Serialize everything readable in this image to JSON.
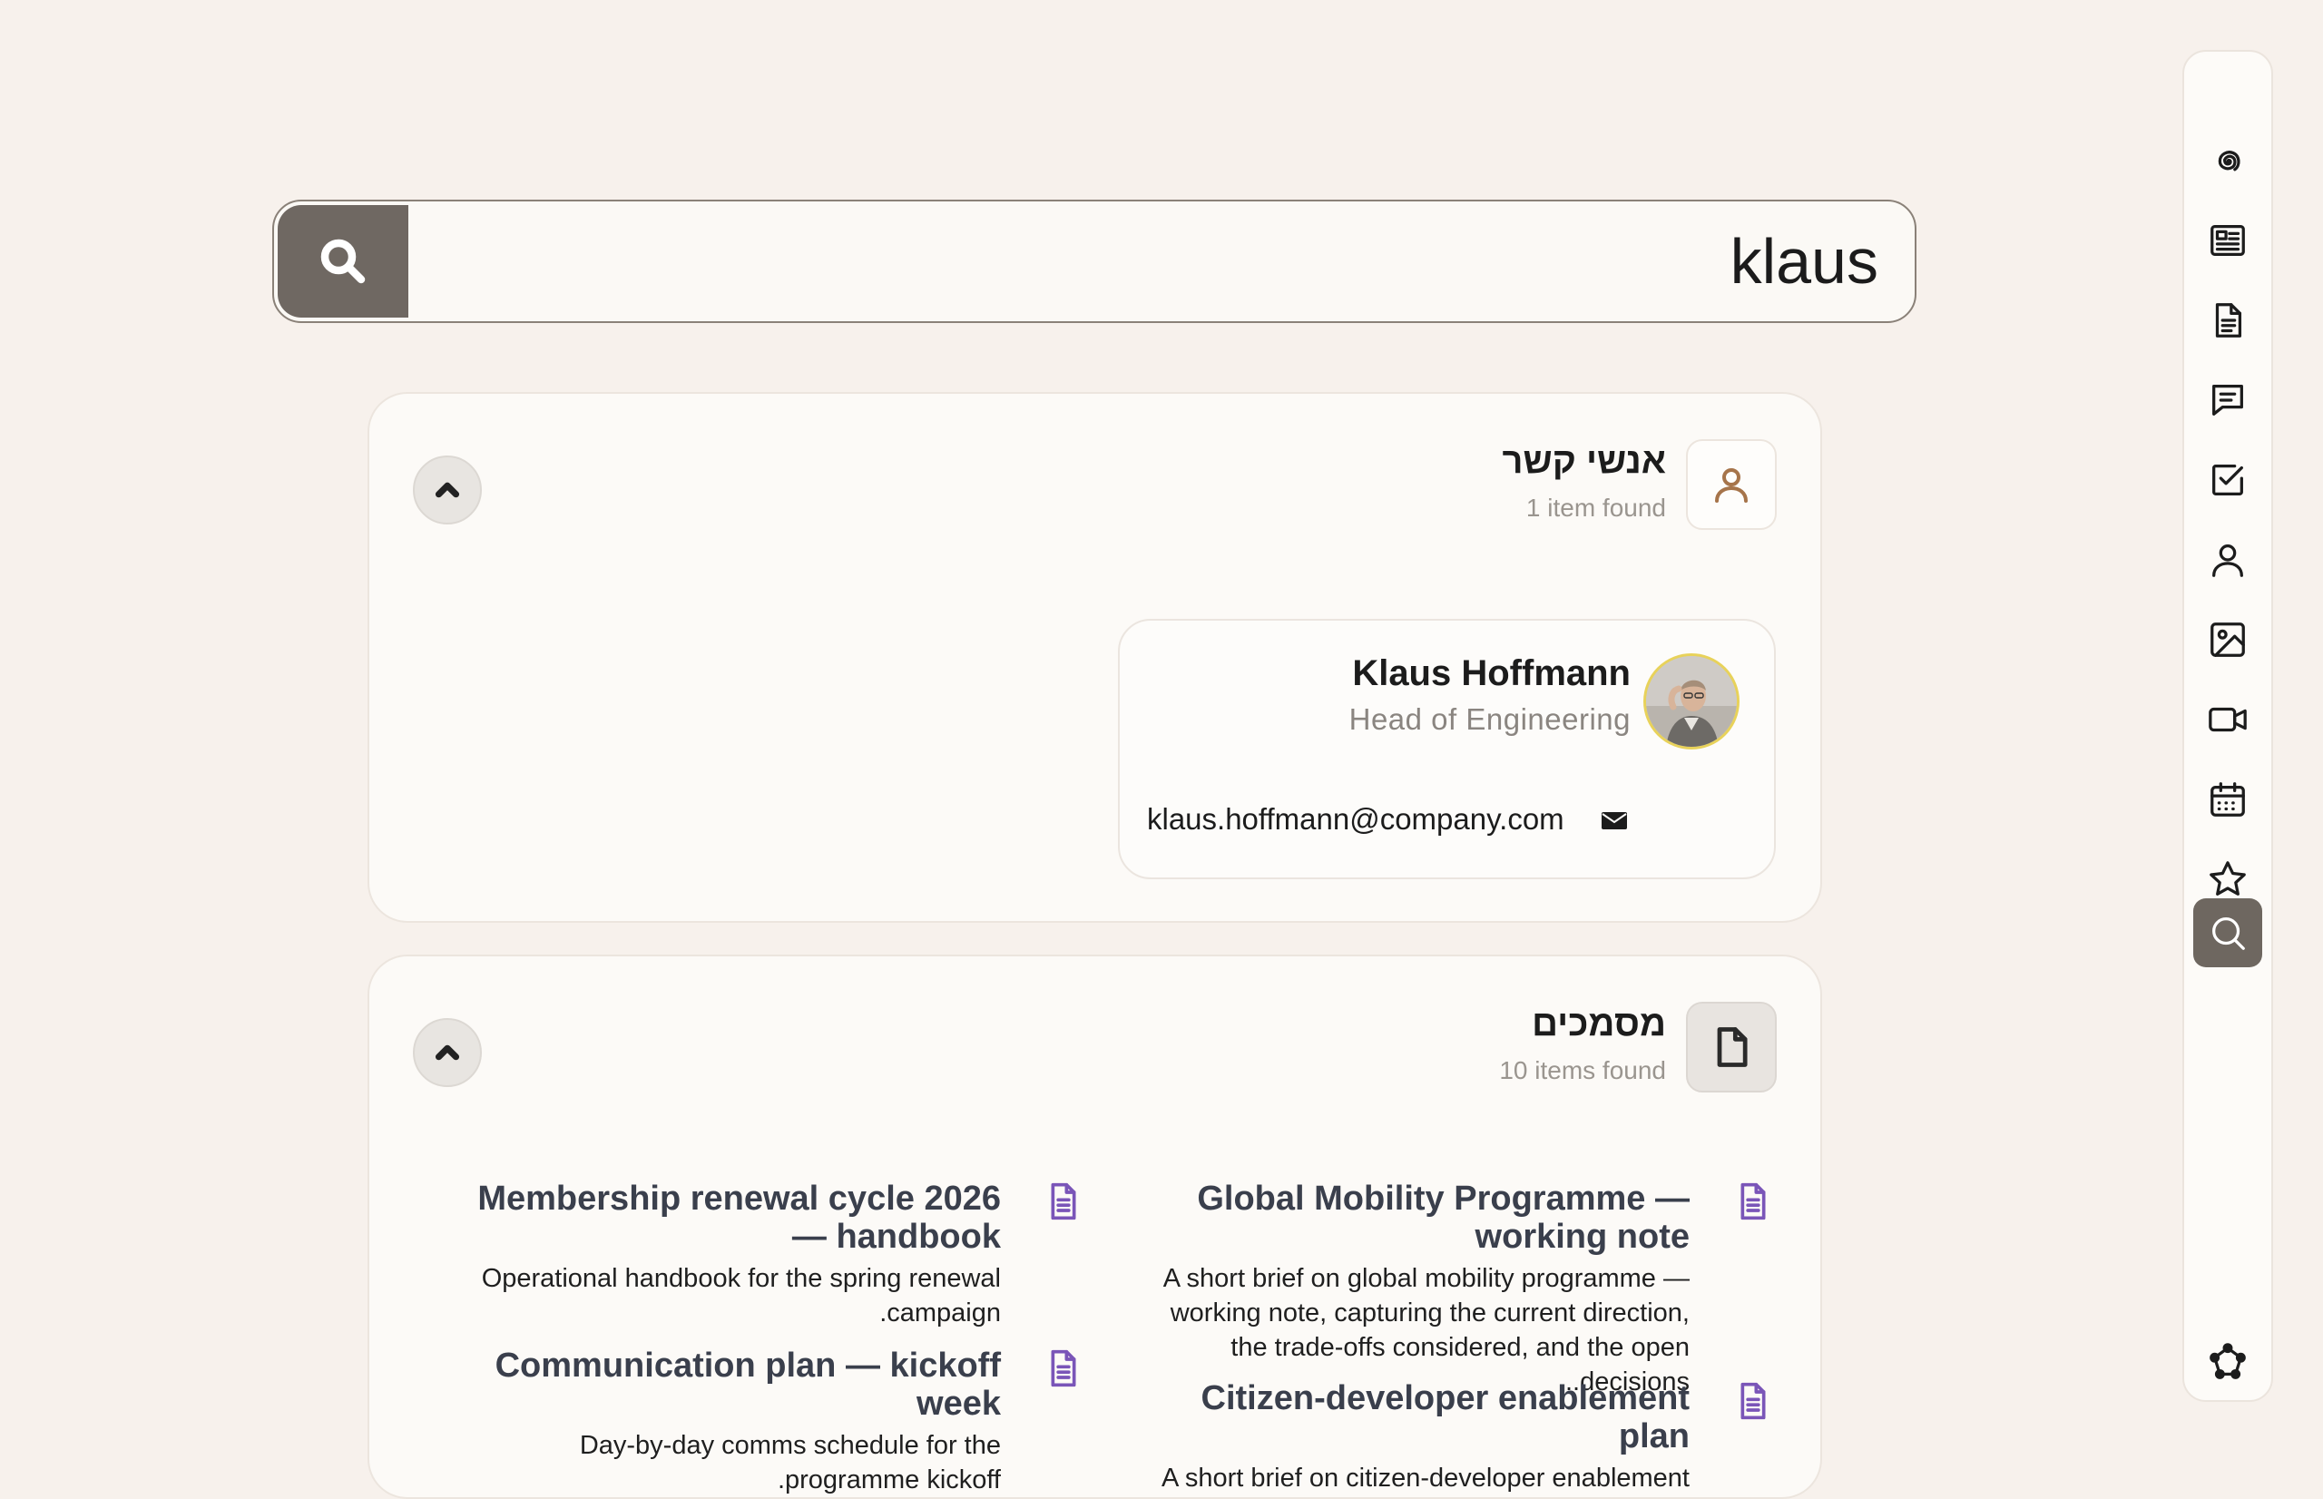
{
  "search": {
    "value": "klaus",
    "button_icon": "search-icon"
  },
  "rail": {
    "items": [
      {
        "icon": "swirl-icon",
        "active": false
      },
      {
        "icon": "newspaper-icon",
        "active": false
      },
      {
        "icon": "document-icon",
        "active": false
      },
      {
        "icon": "chat-icon",
        "active": false
      },
      {
        "icon": "checkbox-icon",
        "active": false
      },
      {
        "icon": "person-icon",
        "active": false
      },
      {
        "icon": "image-icon",
        "active": false
      },
      {
        "icon": "video-icon",
        "active": false
      },
      {
        "icon": "calendar-icon",
        "active": false
      },
      {
        "icon": "star-icon",
        "active": true
      },
      {
        "icon": "search-icon",
        "active": true
      },
      {
        "icon": "network-icon",
        "active": false
      }
    ],
    "active_color": "#6e6760"
  },
  "contacts": {
    "title": "אנשי קשר",
    "count": "1 item found",
    "card": {
      "name": "Klaus Hoffmann",
      "role": "Head of Engineering",
      "email": "klaus.hoffmann@company.com"
    }
  },
  "documents": {
    "title": "מסמכים",
    "count": "10 items found",
    "items": [
      {
        "title": "Global Mobility Programme — working note",
        "description": "A short brief on global mobility programme — working note, capturing the current direction, the trade-offs considered, and the open decisions..."
      },
      {
        "title": "Membership renewal cycle 2026 — handbook",
        "description": "Operational handbook for the spring renewal campaign."
      },
      {
        "title": "Communication plan — kickoff week",
        "description": "Day-by-day comms schedule for the programme kickoff."
      },
      {
        "title": "Citizen-developer enablement plan",
        "description": "A short brief on citizen-developer enablement"
      }
    ]
  },
  "colors": {
    "background": "#f7f1ec",
    "panel": "#fcfaf7",
    "search_button": "#6f6862",
    "doc_icon": "#7a55b8",
    "doc_title": "#3a3f4c"
  }
}
